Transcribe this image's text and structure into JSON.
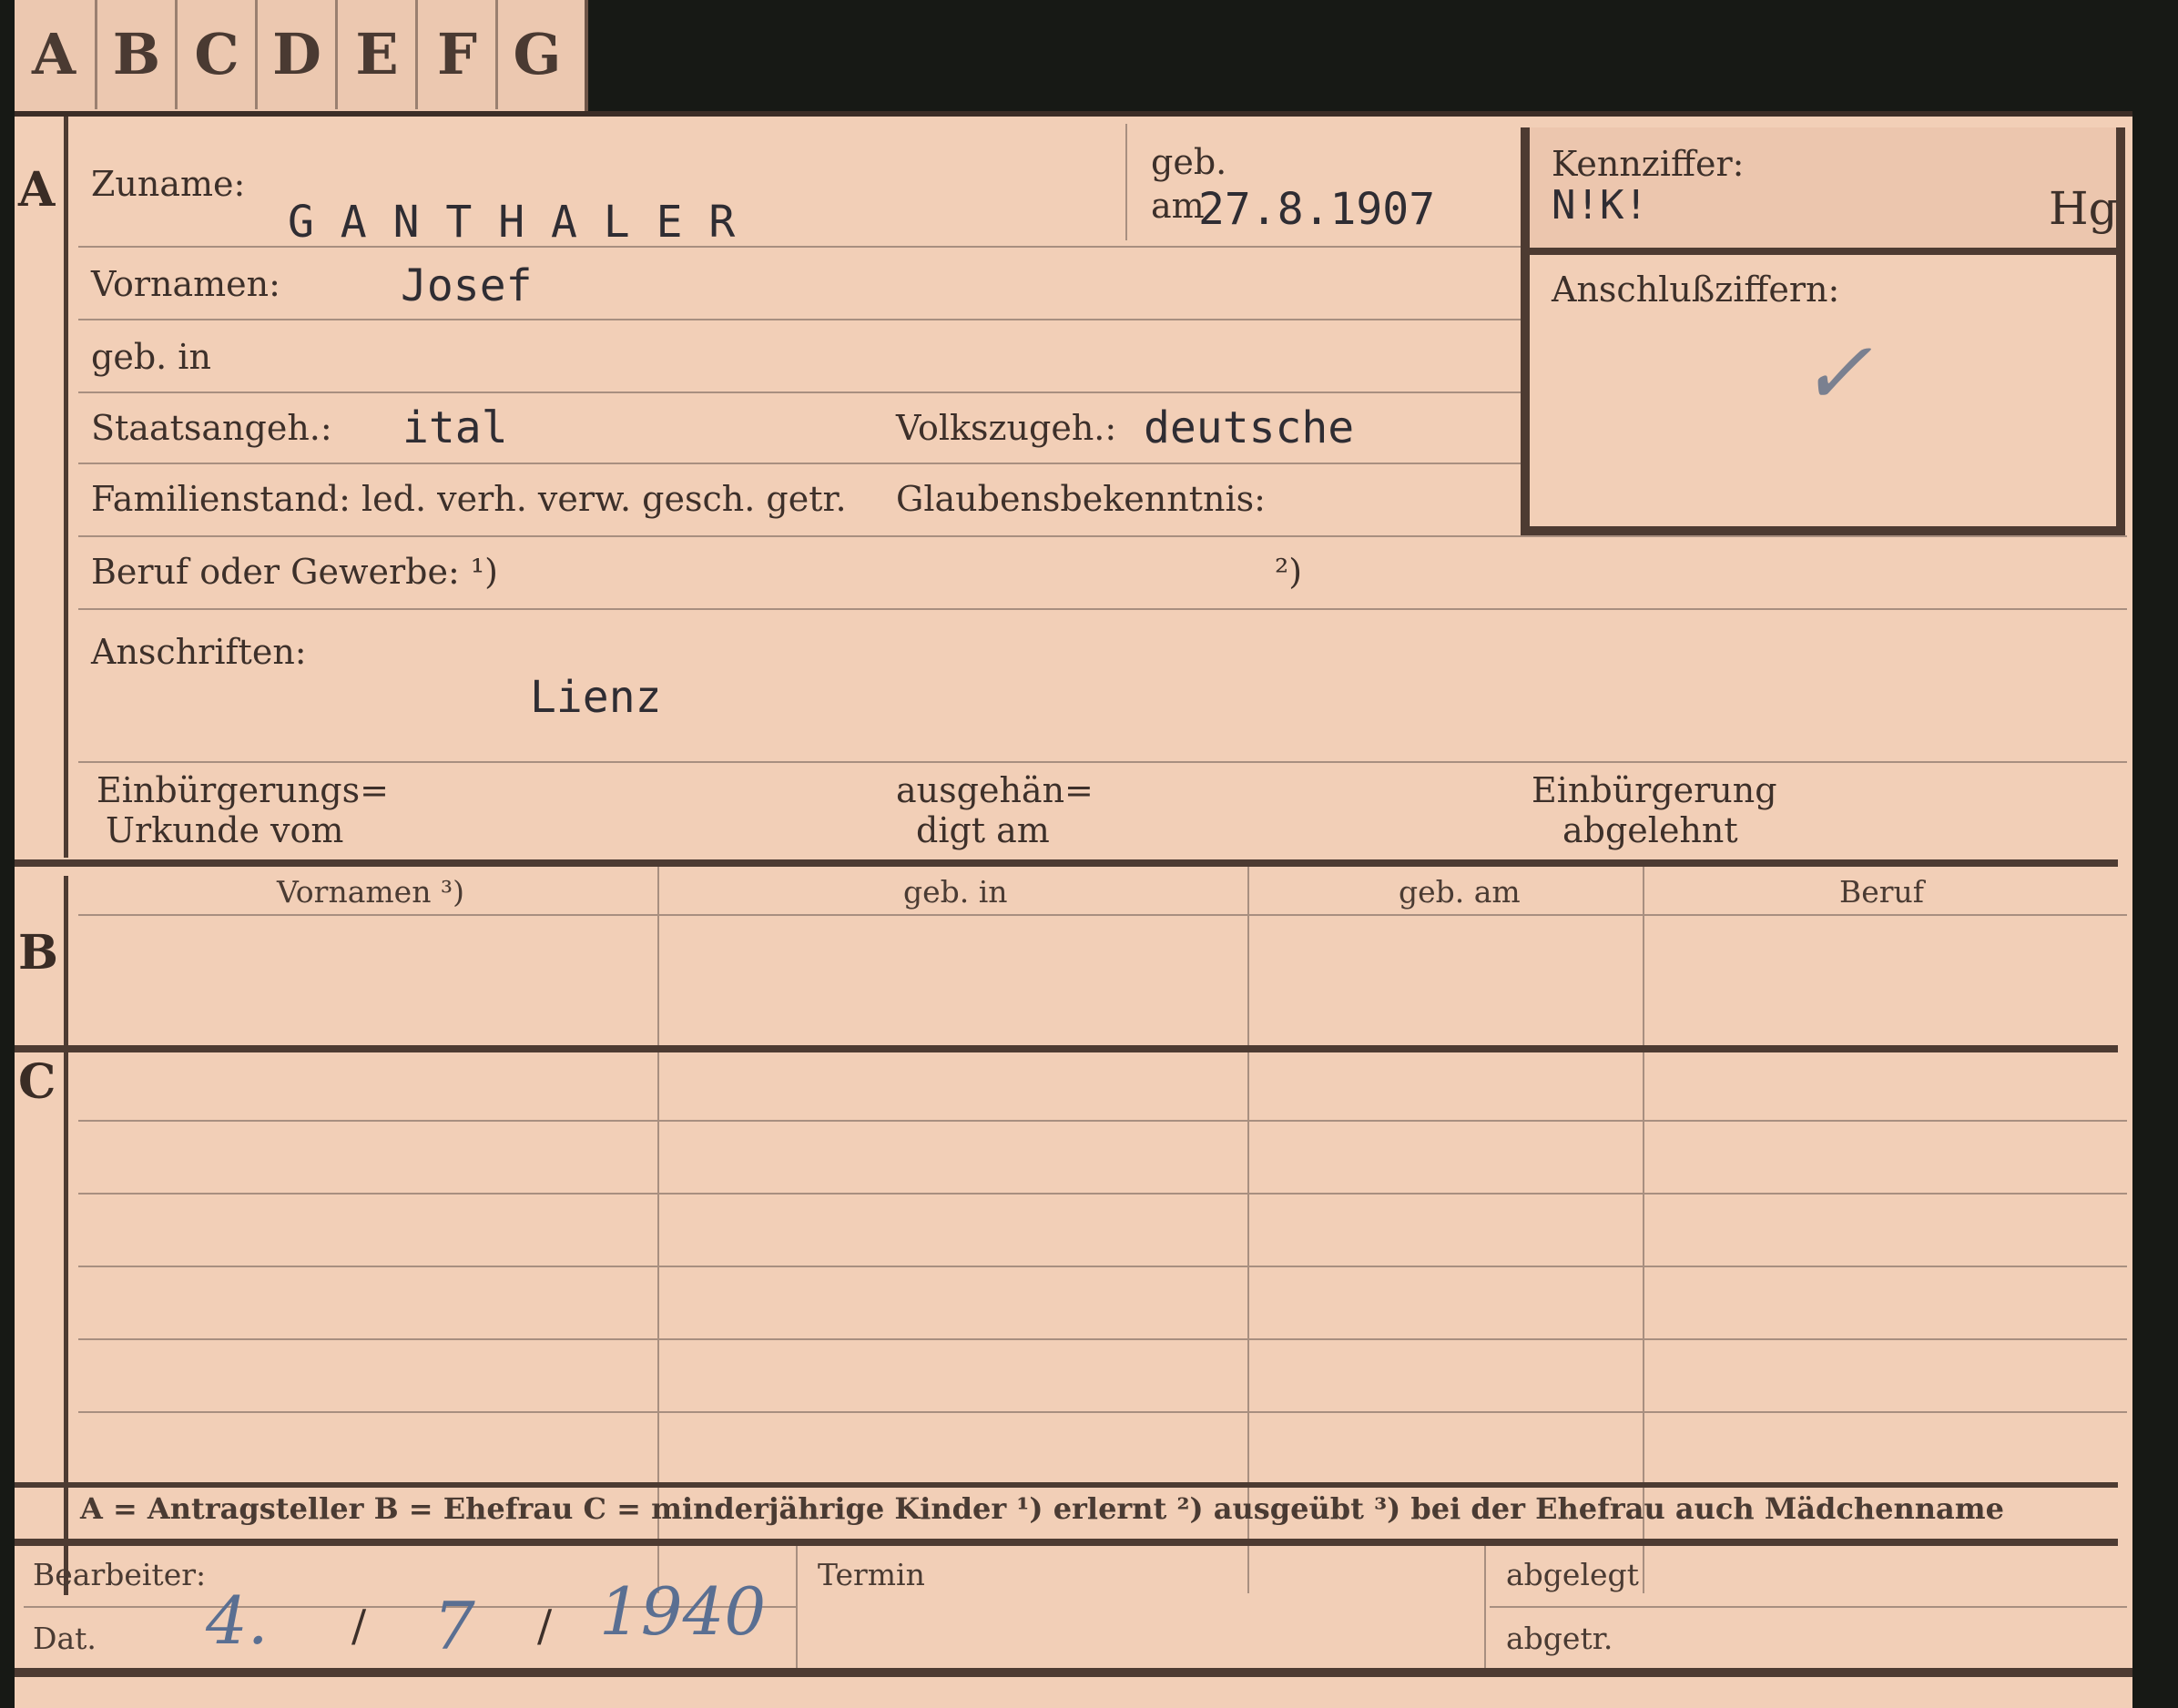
{
  "tabs": [
    "A",
    "B",
    "C",
    "D",
    "E",
    "F",
    "G"
  ],
  "section_letters": {
    "a": "A",
    "b": "B",
    "c": "C"
  },
  "fields": {
    "zuname_label": "Zuname:",
    "zuname_value": "G A N T H A L E R",
    "geb_label": "geb.",
    "geb_am_label": "am",
    "geb_am_value": "27.8.1907",
    "kennziffer_label": "Kennziffer:",
    "kennziffer_value": "N!K!",
    "kennziffer_note": "Hg",
    "anschluss_label": "Anschlußziffern:",
    "check_mark": "✓",
    "vornamen_label": "Vornamen:",
    "vornamen_value": "Josef",
    "geb_in_label": "geb. in",
    "staatsangeh_label": "Staatsangeh.:",
    "staatsangeh_value": "ital",
    "volkszugeh_label": "Volkszugeh.:",
    "volkszugeh_value": "deutsche",
    "familienstand_label": "Familienstand: led. verh. verw. gesch. getr.",
    "glaubens_label": "Glaubensbekenntnis:",
    "beruf_label": "Beruf oder Gewerbe: ¹)",
    "beruf_note2": "²)",
    "anschriften_label": "Anschriften:",
    "anschriften_value": "Lienz",
    "einb_urkunde_1": "Einbürgerungs=",
    "einb_urkunde_2": "Urkunde vom",
    "ausgeh_1": "ausgehän=",
    "ausgeh_2": "digt am",
    "einb_abgelehnt_1": "Einbürgerung",
    "einb_abgelehnt_2": "abgelehnt"
  },
  "table": {
    "headers": [
      "Vornamen ³)",
      "geb. in",
      "geb. am",
      "Beruf"
    ]
  },
  "legend": "A = Antragsteller   B = Ehefrau   C = minderjährige Kinder   ¹) erlernt   ²) ausgeübt   ³) bei der Ehefrau auch Mädchenname",
  "footer": {
    "bearbeiter_label": "Bearbeiter:",
    "dat_label": "Dat.",
    "dat_day": "4.",
    "dat_sep1": "/",
    "dat_month": "7",
    "dat_sep2": "/",
    "dat_year": "1940",
    "termin_label": "Termin",
    "abgelegt_label": "abgelegt",
    "abgetr_label": "abgetr."
  }
}
